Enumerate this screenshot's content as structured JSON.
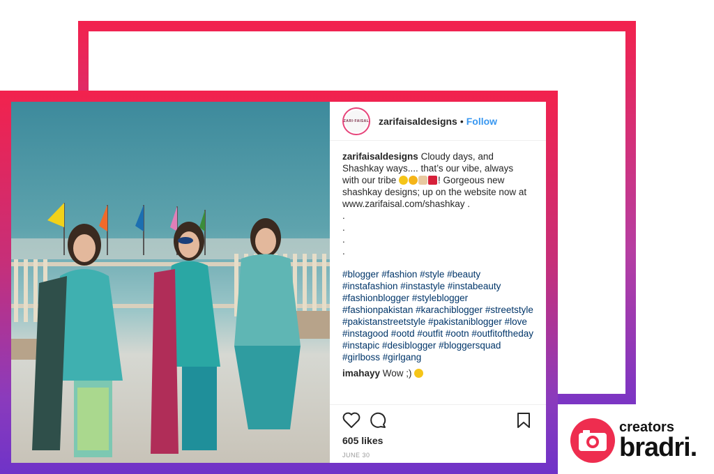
{
  "post": {
    "username": "zarifaisaldesigns",
    "separator": "•",
    "follow_label": "Follow",
    "avatar_text": "ZARI·FAISAL",
    "caption": {
      "user": "zarifaisaldesigns",
      "line1": " Cloudy days, and",
      "line2": "Shashkay ways.... that’s our vibe, always",
      "line3a": "with our tribe ",
      "line3b": "! Gorgeous new",
      "line4": "shashkay designs; up on the website now at",
      "line5": "www.zarifaisal.com/shashkay ."
    },
    "dots": [
      ".",
      ".",
      ".",
      "."
    ],
    "hashtags": "#blogger #fashion #style #beauty #instafashion #instastyle #instabeauty #fashionblogger #styleblogger #fashionpakistan #karachiblogger #streetstyle #pakistanstreetstyle #pakistaniblogger #love #instagood #ootd #outfit #ootn #outfitoftheday #instapic #desiblogger #bloggersquad #girlboss #girlgang",
    "comment": {
      "user": "imahayy",
      "text": " Wow ;)"
    },
    "likes": "605 likes",
    "date": "JUNE 30"
  },
  "brand": {
    "top": "creators",
    "bottom": "bradri."
  },
  "colors": {
    "gradient_top": "#f2224d",
    "gradient_bottom": "#6f33c8",
    "link_blue": "#3897f0",
    "hashtag_blue": "#003569",
    "brand_red": "#ee2d4f"
  }
}
